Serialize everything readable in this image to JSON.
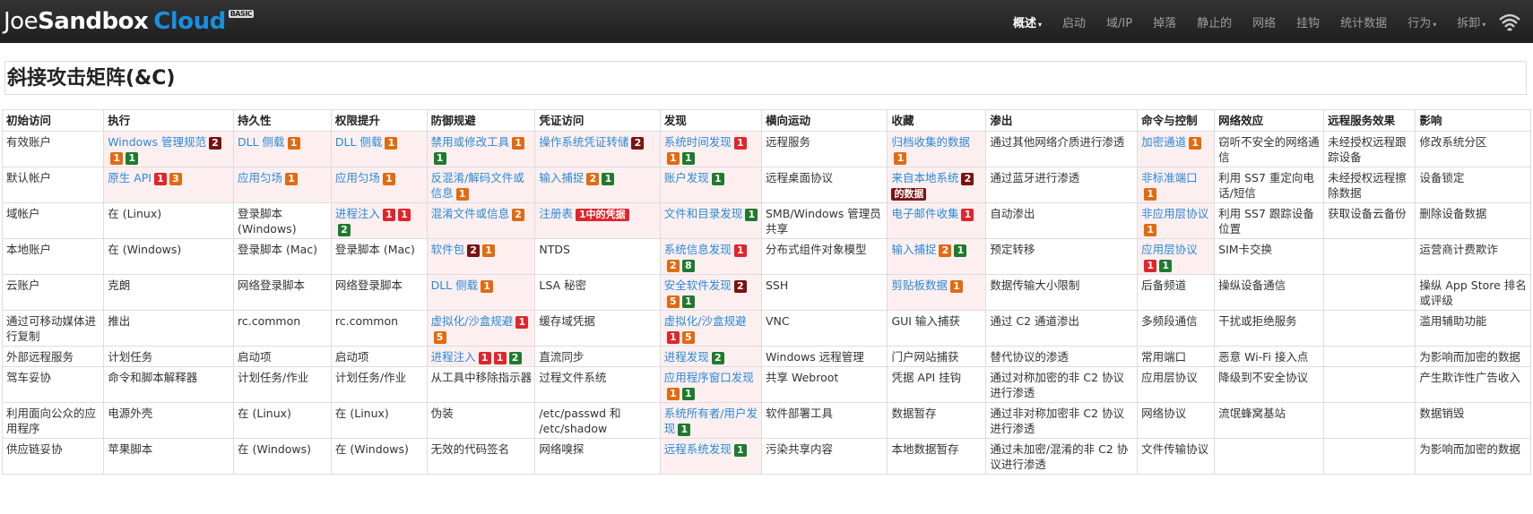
{
  "brand": {
    "joe": "J",
    "oe": "oe",
    "sandbox": "Sandbox",
    "cloud": "Cloud",
    "edition": "BASIC"
  },
  "nav": [
    {
      "label": "概述",
      "active": true,
      "dropdown": true
    },
    {
      "label": "启动",
      "active": false,
      "dropdown": false
    },
    {
      "label": "域/IP",
      "active": false,
      "dropdown": false
    },
    {
      "label": "掉落",
      "active": false,
      "dropdown": false
    },
    {
      "label": "静止的",
      "active": false,
      "dropdown": false
    },
    {
      "label": "网络",
      "active": false,
      "dropdown": false
    },
    {
      "label": "挂钩",
      "active": false,
      "dropdown": false
    },
    {
      "label": "统计数据",
      "active": false,
      "dropdown": false
    },
    {
      "label": "行为",
      "active": false,
      "dropdown": true
    },
    {
      "label": "拆卸",
      "active": false,
      "dropdown": true
    }
  ],
  "nav_icon": "wifi-signal-icon",
  "page_title": "斜接攻击矩阵(&C)",
  "badge_colors": {
    "red": "#e0252b",
    "orange": "#e06b10",
    "green": "#1f7a2e",
    "maroon": "#7a1212"
  },
  "columns": [
    "初始访问",
    "执行",
    "持久性",
    "权限提升",
    "防御规避",
    "凭证访问",
    "发现",
    "横向运动",
    "收藏",
    "渗出",
    "命令与控制",
    "网络效应",
    "远程服务效果",
    "影响"
  ],
  "rows": [
    [
      {
        "t": "有效账户"
      },
      {
        "t": "Windows 管理规范",
        "link": true,
        "hl": true,
        "b": [
          [
            "maroon",
            "2"
          ],
          [
            "orange",
            "1"
          ],
          [
            "green",
            "1"
          ]
        ]
      },
      {
        "t": "DLL 侧载",
        "link": true,
        "hl": true,
        "b": [
          [
            "orange",
            "1"
          ]
        ]
      },
      {
        "t": "DLL 侧载",
        "link": true,
        "hl": true,
        "b": [
          [
            "orange",
            "1"
          ]
        ]
      },
      {
        "t": "禁用或修改工具",
        "link": true,
        "hl": true,
        "b": [
          [
            "orange",
            "1"
          ],
          [
            "green",
            "1"
          ]
        ]
      },
      {
        "t": "操作系统凭证转储",
        "link": true,
        "hl": true,
        "b": [
          [
            "maroon",
            "2"
          ]
        ]
      },
      {
        "t": "系统时间发现",
        "link": true,
        "hl": true,
        "b": [
          [
            "red",
            "1"
          ],
          [
            "orange",
            "1"
          ],
          [
            "green",
            "1"
          ]
        ]
      },
      {
        "t": "远程服务"
      },
      {
        "t": "归档收集的数据",
        "link": true,
        "hl": true,
        "b": [
          [
            "orange",
            "1"
          ]
        ]
      },
      {
        "t": "通过其他网络介质进行渗透"
      },
      {
        "t": "加密通道",
        "link": true,
        "hl": true,
        "b": [
          [
            "orange",
            "1"
          ]
        ]
      },
      {
        "t": "窃听不安全的网络通信"
      },
      {
        "t": "未经授权远程跟踪设备"
      },
      {
        "t": "修改系统分区"
      }
    ],
    [
      {
        "t": "默认帐户"
      },
      {
        "t": "原生 API",
        "link": true,
        "hl": true,
        "b": [
          [
            "red",
            "1"
          ],
          [
            "orange",
            "3"
          ]
        ]
      },
      {
        "t": "应用匀场",
        "link": true,
        "hl": true,
        "b": [
          [
            "orange",
            "1"
          ]
        ]
      },
      {
        "t": "应用匀场",
        "link": true,
        "hl": true,
        "b": [
          [
            "orange",
            "1"
          ]
        ]
      },
      {
        "t": "反混淆/解码文件或信息",
        "link": true,
        "hl": true,
        "b": [
          [
            "orange",
            "1"
          ]
        ]
      },
      {
        "t": "输入捕捉",
        "link": true,
        "hl": true,
        "b": [
          [
            "orange",
            "2"
          ],
          [
            "green",
            "1"
          ]
        ]
      },
      {
        "t": "账户发现",
        "link": true,
        "hl": true,
        "b": [
          [
            "green",
            "1"
          ]
        ]
      },
      {
        "t": "远程桌面协议"
      },
      {
        "t": "来自本地系统",
        "link": true,
        "hl": true,
        "b": [
          [
            "maroon",
            "2"
          ]
        ],
        "tail": "的数据",
        "tailBadge": "maroon"
      },
      {
        "t": "通过蓝牙进行渗透"
      },
      {
        "t": "非标准端口",
        "link": true,
        "hl": true,
        "b": [
          [
            "orange",
            "1"
          ]
        ]
      },
      {
        "t": "利用 SS7 重定向电话/短信"
      },
      {
        "t": "未经授权远程擦除数据"
      },
      {
        "t": "设备锁定"
      }
    ],
    [
      {
        "t": "域帐户"
      },
      {
        "t": "在 (Linux)"
      },
      {
        "t": "登录脚本 (Windows)"
      },
      {
        "t": "进程注入",
        "link": true,
        "hl": true,
        "b": [
          [
            "red",
            "1"
          ],
          [
            "red",
            "1"
          ],
          [
            "green",
            "2"
          ]
        ]
      },
      {
        "t": "混淆文件或信息",
        "link": true,
        "hl": true,
        "b": [
          [
            "orange",
            "2"
          ]
        ]
      },
      {
        "t": "注册表",
        "link": true,
        "hl": true,
        "b": [
          [
            "red",
            "1中的凭据"
          ]
        ]
      },
      {
        "t": "文件和目录发现",
        "link": true,
        "hl": true,
        "b": [
          [
            "green",
            "1"
          ]
        ]
      },
      {
        "t": "SMB/Windows 管理员共享"
      },
      {
        "t": "电子邮件收集",
        "link": true,
        "hl": true,
        "b": [
          [
            "red",
            "1"
          ]
        ]
      },
      {
        "t": "自动渗出"
      },
      {
        "t": "非应用层协议",
        "link": true,
        "hl": true,
        "b": [
          [
            "orange",
            "1"
          ]
        ]
      },
      {
        "t": "利用 SS7 跟踪设备位置"
      },
      {
        "t": "获取设备云备份"
      },
      {
        "t": "删除设备数据"
      }
    ],
    [
      {
        "t": "本地账户"
      },
      {
        "t": "在 (Windows)"
      },
      {
        "t": "登录脚本 (Mac)"
      },
      {
        "t": "登录脚本 (Mac)"
      },
      {
        "t": "软件包",
        "link": true,
        "hl": true,
        "b": [
          [
            "maroon",
            "2"
          ],
          [
            "orange",
            "1"
          ]
        ]
      },
      {
        "t": "NTDS"
      },
      {
        "t": "系统信息发现",
        "link": true,
        "hl": true,
        "b": [
          [
            "red",
            "1"
          ],
          [
            "orange",
            "2"
          ],
          [
            "green",
            "8"
          ]
        ]
      },
      {
        "t": "分布式组件对象模型"
      },
      {
        "t": "输入捕捉",
        "link": true,
        "hl": true,
        "b": [
          [
            "orange",
            "2"
          ],
          [
            "green",
            "1"
          ]
        ]
      },
      {
        "t": "预定转移"
      },
      {
        "t": "应用层协议",
        "link": true,
        "hl": true,
        "b": [
          [
            "red",
            "1"
          ],
          [
            "green",
            "1"
          ]
        ]
      },
      {
        "t": "SIM卡交换"
      },
      {
        "t": ""
      },
      {
        "t": "运营商计费欺诈"
      }
    ],
    [
      {
        "t": "云账户"
      },
      {
        "t": "克朗"
      },
      {
        "t": "网络登录脚本"
      },
      {
        "t": "网络登录脚本"
      },
      {
        "t": "DLL 侧载",
        "link": true,
        "hl": true,
        "b": [
          [
            "orange",
            "1"
          ]
        ]
      },
      {
        "t": "LSA 秘密"
      },
      {
        "t": "安全软件发现",
        "link": true,
        "hl": true,
        "b": [
          [
            "maroon",
            "2"
          ],
          [
            "orange",
            "5"
          ],
          [
            "green",
            "1"
          ]
        ]
      },
      {
        "t": "SSH"
      },
      {
        "t": "剪贴板数据",
        "link": true,
        "hl": true,
        "b": [
          [
            "orange",
            "1"
          ]
        ]
      },
      {
        "t": "数据传输大小限制"
      },
      {
        "t": "后备频道"
      },
      {
        "t": "操纵设备通信"
      },
      {
        "t": ""
      },
      {
        "t": "操纵 App Store 排名或评级"
      }
    ],
    [
      {
        "t": "通过可移动媒体进行复制"
      },
      {
        "t": "推出"
      },
      {
        "t": "rc.common"
      },
      {
        "t": "rc.common"
      },
      {
        "t": "虚拟化/沙盒规避",
        "link": true,
        "hl": true,
        "b": [
          [
            "red",
            "1"
          ],
          [
            "orange",
            "5"
          ]
        ]
      },
      {
        "t": "缓存域凭据"
      },
      {
        "t": "虚拟化/沙盒规避",
        "link": true,
        "hl": true,
        "b": [
          [
            "red",
            "1"
          ],
          [
            "orange",
            "5"
          ]
        ]
      },
      {
        "t": "VNC"
      },
      {
        "t": "GUI 输入捕获"
      },
      {
        "t": "通过 C2 通道渗出"
      },
      {
        "t": "多频段通信"
      },
      {
        "t": "干扰或拒绝服务"
      },
      {
        "t": ""
      },
      {
        "t": "滥用辅助功能"
      }
    ],
    [
      {
        "t": "外部远程服务"
      },
      {
        "t": "计划任务"
      },
      {
        "t": "启动项"
      },
      {
        "t": "启动项"
      },
      {
        "t": "进程注入",
        "link": true,
        "hl": true,
        "b": [
          [
            "red",
            "1"
          ],
          [
            "red",
            "1"
          ],
          [
            "green",
            "2"
          ]
        ]
      },
      {
        "t": "直流同步"
      },
      {
        "t": "进程发现",
        "link": true,
        "hl": true,
        "b": [
          [
            "green",
            "2"
          ]
        ]
      },
      {
        "t": "Windows 远程管理"
      },
      {
        "t": "门户网站捕获"
      },
      {
        "t": "替代协议的渗透"
      },
      {
        "t": "常用端口"
      },
      {
        "t": "恶意 Wi-Fi 接入点"
      },
      {
        "t": ""
      },
      {
        "t": "为影响而加密的数据"
      }
    ],
    [
      {
        "t": "驾车妥协"
      },
      {
        "t": "命令和脚本解释器"
      },
      {
        "t": "计划任务/作业"
      },
      {
        "t": "计划任务/作业"
      },
      {
        "t": "从工具中移除指示器"
      },
      {
        "t": "过程文件系统"
      },
      {
        "t": "应用程序窗口发现",
        "link": true,
        "hl": true,
        "b": [
          [
            "orange",
            "1"
          ],
          [
            "green",
            "1"
          ]
        ]
      },
      {
        "t": "共享 Webroot"
      },
      {
        "t": "凭据 API 挂钩"
      },
      {
        "t": "通过对称加密的非 C2 协议进行渗透"
      },
      {
        "t": "应用层协议"
      },
      {
        "t": "降级到不安全协议"
      },
      {
        "t": ""
      },
      {
        "t": "产生欺诈性广告收入"
      }
    ],
    [
      {
        "t": "利用面向公众的应用程序"
      },
      {
        "t": "电源外壳"
      },
      {
        "t": "在 (Linux)"
      },
      {
        "t": "在 (Linux)"
      },
      {
        "t": "伪装"
      },
      {
        "t": "/etc/passwd 和 /etc/shadow"
      },
      {
        "t": "系统所有者/用户发现",
        "link": true,
        "hl": true,
        "b": [
          [
            "green",
            "1"
          ]
        ]
      },
      {
        "t": "软件部署工具"
      },
      {
        "t": "数据暂存"
      },
      {
        "t": "通过非对称加密非 C2 协议进行渗透"
      },
      {
        "t": "网络协议"
      },
      {
        "t": "流氓蜂窝基站"
      },
      {
        "t": ""
      },
      {
        "t": "数据销毁"
      }
    ],
    [
      {
        "t": "供应链妥协"
      },
      {
        "t": "苹果脚本"
      },
      {
        "t": "在 (Windows)"
      },
      {
        "t": "在 (Windows)"
      },
      {
        "t": "无效的代码签名"
      },
      {
        "t": "网络嗅探"
      },
      {
        "t": "远程系统发现",
        "link": true,
        "hl": true,
        "b": [
          [
            "green",
            "1"
          ]
        ]
      },
      {
        "t": "污染共享内容"
      },
      {
        "t": "本地数据暂存"
      },
      {
        "t": "通过未加密/混淆的非 C2 协议进行渗透"
      },
      {
        "t": "文件传输协议"
      },
      {
        "t": ""
      },
      {
        "t": ""
      },
      {
        "t": "为影响而加密的数据"
      }
    ]
  ]
}
